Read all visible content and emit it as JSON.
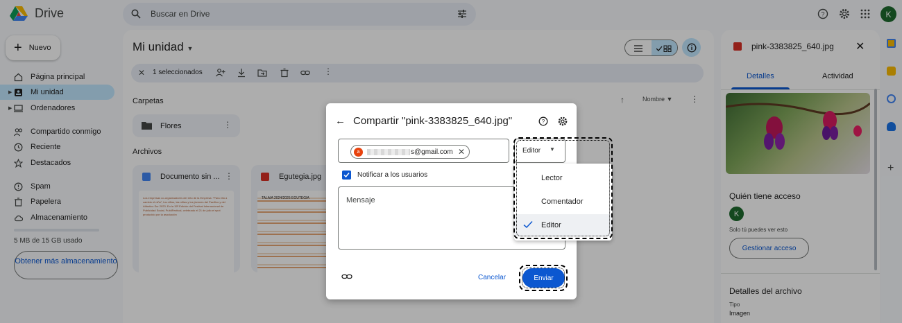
{
  "app": {
    "name": "Drive"
  },
  "search": {
    "placeholder": "Buscar en Drive"
  },
  "user": {
    "initial": "K"
  },
  "sidebar": {
    "new_label": "Nuevo",
    "items": [
      {
        "label": "Página principal"
      },
      {
        "label": "Mi unidad"
      },
      {
        "label": "Ordenadores"
      },
      {
        "label": "Compartido conmigo"
      },
      {
        "label": "Reciente"
      },
      {
        "label": "Destacados"
      },
      {
        "label": "Spam"
      },
      {
        "label": "Papelera"
      },
      {
        "label": "Almacenamiento"
      }
    ],
    "storage_text": "5 MB de 15 GB usado",
    "storage_fraction": 0.0003,
    "more_storage": "Obtener más almacenamiento"
  },
  "main": {
    "title": "Mi unidad",
    "selection_count": "1 seleccionados",
    "folders_label": "Carpetas",
    "files_label": "Archivos",
    "sort_label": "Nombre",
    "folders": [
      {
        "name": "Flores"
      }
    ],
    "files": [
      {
        "name": "Documento sin ...",
        "preview": "Los empresas co-organizadores del reto de la Empresa: \"Para ello a cambio el niño\", los niños, las niñas y los jóvenes del Pacífico y del Atlántico Sur 2023. En la 15ª Edición del Festival Internacional de Publicidad Social, PubliFestival, celebrado el 21 de julio el spot producido por la asociación"
      },
      {
        "name": "Egutegia.jpg",
        "preview": "TALAIA 2024/2025 EGUTEGIA"
      }
    ]
  },
  "share_dialog": {
    "title": "Compartir \"pink-3383825_640.jpg\"",
    "recipient_initial": "a",
    "recipient_email": "s@gmail.com",
    "role": "Editor",
    "notify_label": "Notificar a los usuarios",
    "notify_checked": true,
    "message_placeholder": "Mensaje",
    "cancel_label": "Cancelar",
    "send_label": "Enviar"
  },
  "role_menu": {
    "options": [
      {
        "label": "Lector",
        "checked": false
      },
      {
        "label": "Comentador",
        "checked": false
      },
      {
        "label": "Editor",
        "checked": true
      }
    ]
  },
  "details_panel": {
    "file_name": "pink-3383825_640.jpg",
    "tabs": [
      {
        "label": "Detalles",
        "active": true
      },
      {
        "label": "Actividad",
        "active": false
      }
    ],
    "access_title": "Quién tiene acceso",
    "access_avatar": "K",
    "access_note": "Solo tú puedes ver esto",
    "manage_access": "Gestionar acceso",
    "file_details_title": "Detalles del archivo",
    "type_label": "Tipo",
    "type_value": "Imagen"
  },
  "colors": {
    "accent": "#0b57d0",
    "selected_bg": "#c2e7ff",
    "avatar_green": "#1e6b2e",
    "image_red": "#d93025"
  }
}
